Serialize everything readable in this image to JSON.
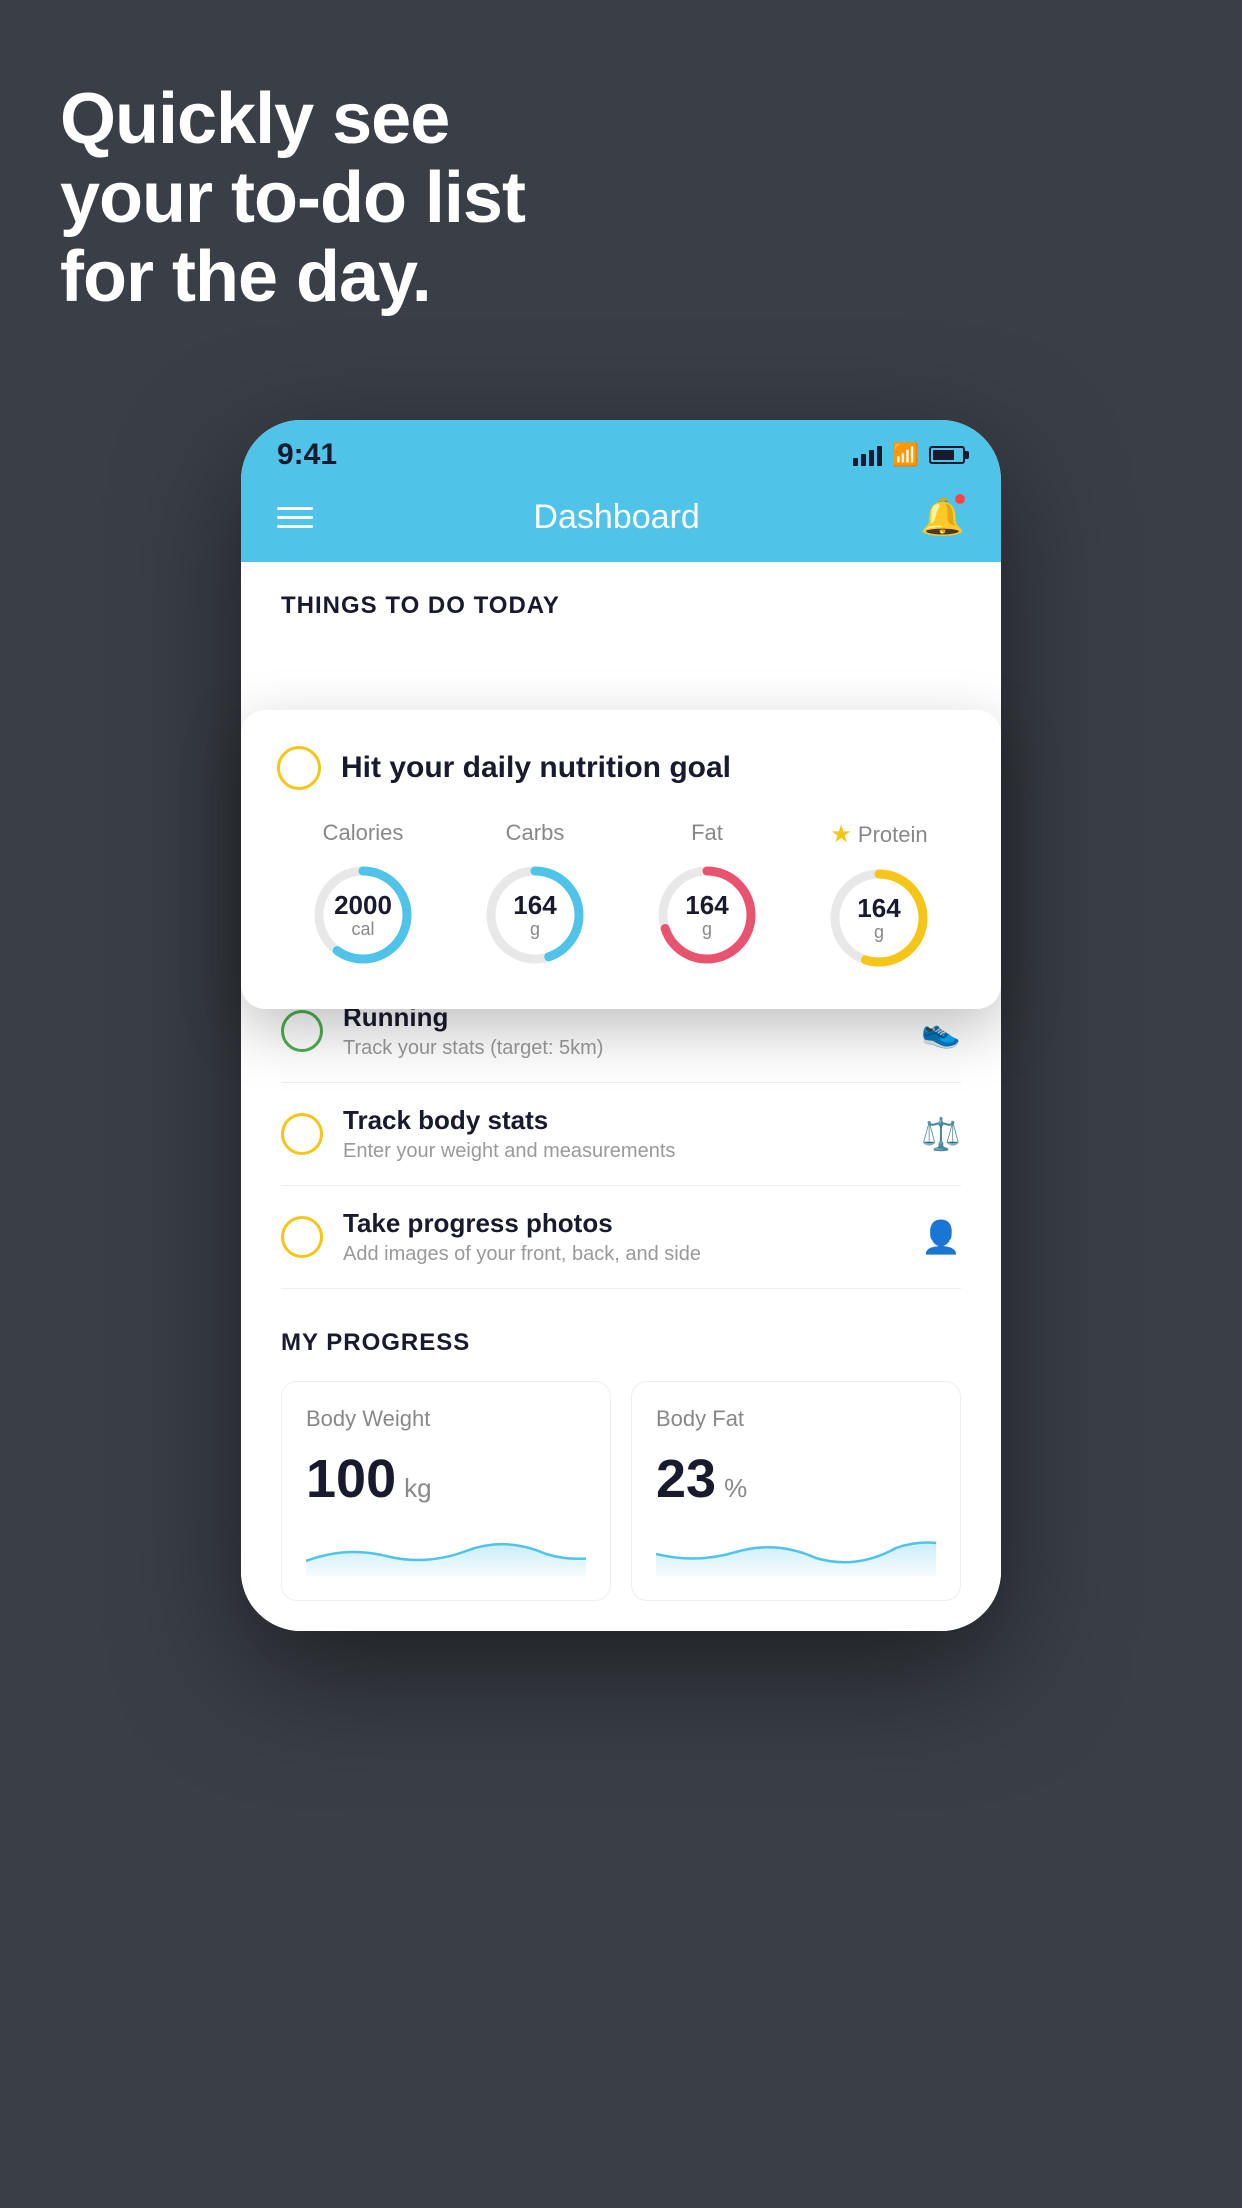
{
  "background_color": "#3a3f47",
  "hero": {
    "line1": "Quickly see",
    "line2": "your to-do list",
    "line3": "for the day."
  },
  "status_bar": {
    "time": "9:41",
    "signal_label": "signal",
    "wifi_label": "wifi",
    "battery_label": "battery"
  },
  "header": {
    "title": "Dashboard",
    "menu_label": "menu",
    "bell_label": "notifications"
  },
  "things_section": {
    "heading": "THINGS TO DO TODAY"
  },
  "nutrition_card": {
    "circle_label": "unchecked",
    "title": "Hit your daily nutrition goal",
    "nutrients": [
      {
        "label": "Calories",
        "value": "2000",
        "unit": "cal",
        "color": "#4fc3e8",
        "track_pct": 0.6,
        "starred": false
      },
      {
        "label": "Carbs",
        "value": "164",
        "unit": "g",
        "color": "#4fc3e8",
        "track_pct": 0.45,
        "starred": false
      },
      {
        "label": "Fat",
        "value": "164",
        "unit": "g",
        "color": "#e85470",
        "track_pct": 0.7,
        "starred": false
      },
      {
        "label": "Protein",
        "value": "164",
        "unit": "g",
        "color": "#f5c518",
        "track_pct": 0.55,
        "starred": true
      }
    ]
  },
  "todo_items": [
    {
      "id": "running",
      "circle_type": "green",
      "title": "Running",
      "subtitle": "Track your stats (target: 5km)",
      "icon": "shoe"
    },
    {
      "id": "track-body",
      "circle_type": "yellow",
      "title": "Track body stats",
      "subtitle": "Enter your weight and measurements",
      "icon": "scale"
    },
    {
      "id": "progress-photos",
      "circle_type": "yellow",
      "title": "Take progress photos",
      "subtitle": "Add images of your front, back, and side",
      "icon": "person"
    }
  ],
  "progress_section": {
    "heading": "MY PROGRESS",
    "cards": [
      {
        "id": "body-weight",
        "title": "Body Weight",
        "value": "100",
        "unit": "kg"
      },
      {
        "id": "body-fat",
        "title": "Body Fat",
        "value": "23",
        "unit": "%"
      }
    ]
  }
}
